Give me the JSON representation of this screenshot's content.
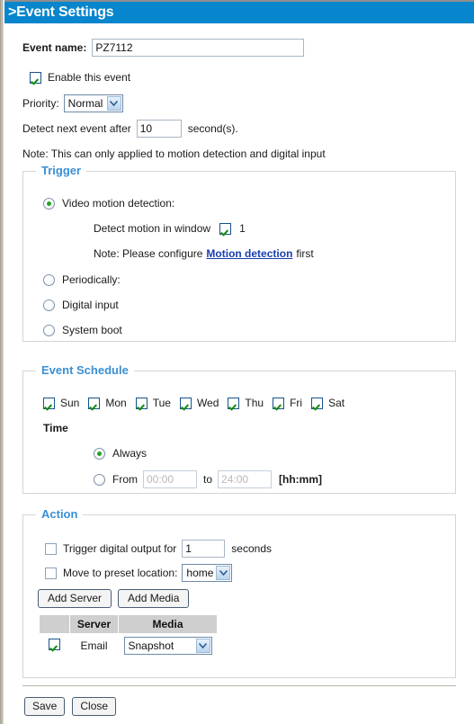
{
  "window": {
    "title": ">Event Settings"
  },
  "form": {
    "event_name_label": "Event name:",
    "event_name_value": "PZ7112",
    "enable_event_label": "Enable this event",
    "enable_event_checked": true,
    "priority_label": "Priority:",
    "priority_value": "Normal",
    "detect_next_prefix": "Detect next event after",
    "detect_next_value": "10",
    "detect_next_suffix": "second(s).",
    "note": "Note: This can only applied to motion detection and digital input"
  },
  "trigger": {
    "legend": "Trigger",
    "options": [
      {
        "label": "Video motion detection:",
        "selected": true
      },
      {
        "label": "Periodically:",
        "selected": false
      },
      {
        "label": "Digital input",
        "selected": false
      },
      {
        "label": "System boot",
        "selected": false
      }
    ],
    "detect_window_label": "Detect motion in window",
    "detect_window_checked": true,
    "detect_window_number": "1",
    "note_prefix": "Note: Please configure",
    "note_link": "Motion detection",
    "note_suffix": "first"
  },
  "schedule": {
    "legend": "Event Schedule",
    "days": [
      {
        "label": "Sun",
        "checked": true
      },
      {
        "label": "Mon",
        "checked": true
      },
      {
        "label": "Tue",
        "checked": true
      },
      {
        "label": "Wed",
        "checked": true
      },
      {
        "label": "Thu",
        "checked": true
      },
      {
        "label": "Fri",
        "checked": true
      },
      {
        "label": "Sat",
        "checked": true
      }
    ],
    "time_label": "Time",
    "always_label": "Always",
    "always_selected": true,
    "from_label": "From",
    "from_value": "00:00",
    "to_label": "to",
    "to_value": "24:00",
    "format_hint": "[hh:mm]",
    "range_selected": false
  },
  "action": {
    "legend": "Action",
    "trigger_output_label": "Trigger digital output for",
    "trigger_output_checked": false,
    "trigger_output_value": "1",
    "trigger_output_suffix": "seconds",
    "preset_label": "Move to preset location:",
    "preset_checked": false,
    "preset_value": "home",
    "add_server_label": "Add Server",
    "add_media_label": "Add Media",
    "table": {
      "headers": [
        "",
        "Server",
        "Media"
      ],
      "rows": [
        {
          "checked": true,
          "server": "Email",
          "media": "Snapshot"
        }
      ]
    }
  },
  "footer": {
    "save_label": "Save",
    "close_label": "Close"
  },
  "colors": {
    "header_blue": "#0785cd",
    "legend_blue": "#3b8fd4",
    "check_green": "#118a11",
    "link_blue": "#1a3fb0"
  }
}
